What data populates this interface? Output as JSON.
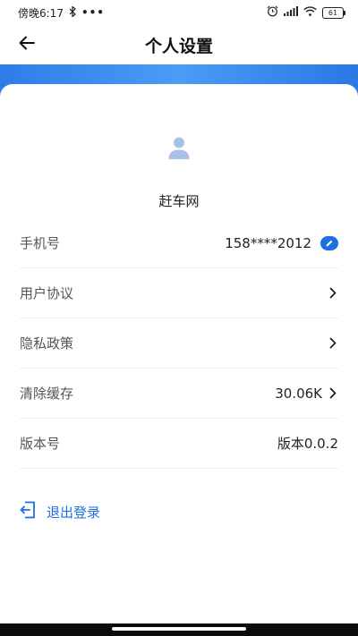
{
  "status_bar": {
    "time": "傍晚6:17",
    "more": "•••",
    "battery": "61"
  },
  "header": {
    "title": "个人设置"
  },
  "profile": {
    "name": "赶车网"
  },
  "settings": [
    {
      "label": "手机号",
      "value": "158****2012",
      "action": "edit"
    },
    {
      "label": "用户协议",
      "value": "",
      "action": "chevron"
    },
    {
      "label": "隐私政策",
      "value": "",
      "action": "chevron"
    },
    {
      "label": "清除缓存",
      "value": "30.06K",
      "action": "chevron"
    },
    {
      "label": "版本号",
      "value": "版本0.0.2",
      "action": "none"
    }
  ],
  "logout": {
    "label": "退出登录"
  },
  "colors": {
    "accent": "#1e6fe0",
    "band_start": "#2e7de8",
    "band_end": "#4a9cf5",
    "avatar": "#a9c0e8"
  },
  "icons": {
    "back": "arrow-left-icon",
    "avatar": "user-avatar-icon",
    "edit": "edit-pencil-icon",
    "chevron": "chevron-right-icon",
    "logout": "logout-icon"
  }
}
